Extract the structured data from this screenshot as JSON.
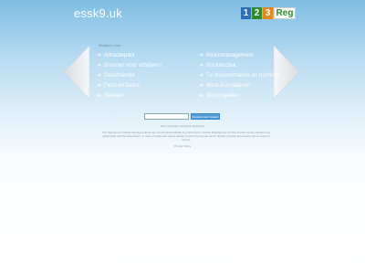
{
  "header": {
    "domain": "essk9.uk",
    "logo": {
      "digits": [
        "1",
        "2",
        "3"
      ],
      "digit_colors": [
        "#2f6fb6",
        "#2f8b2f",
        "#e08a1e"
      ],
      "reg": "Reg"
    }
  },
  "links_header": "Related Links",
  "links_left": [
    "Attractiepark",
    "Bronnen voor schrijvers",
    "Detailhandel",
    "Flora en fauna",
    "Markten"
  ],
  "links_right": [
    "Risicomanagement",
    "Rockmuziek",
    "Tv-documentaires en nonfictie",
    "West-Europeanen",
    "Woordspellen"
  ],
  "arrow_glyph": "➜",
  "search": {
    "button_label": "Zoekwoorden zoeken"
  },
  "footer": {
    "copyright": "2014 Copyright. All Rights Reserved.",
    "disclaimer": "The Sponsored Listings displayed above are served automatically by a third party. Neither Parkingcrew nor the domain owner maintain any relationship with the advertisers. In case of trademark issues please contact the domain owner directly (contact information can be found in whois).",
    "privacy": "Privacy Policy"
  },
  "colors": {
    "link_text": "#ffffff",
    "button_bg": "#4d9bdb"
  }
}
